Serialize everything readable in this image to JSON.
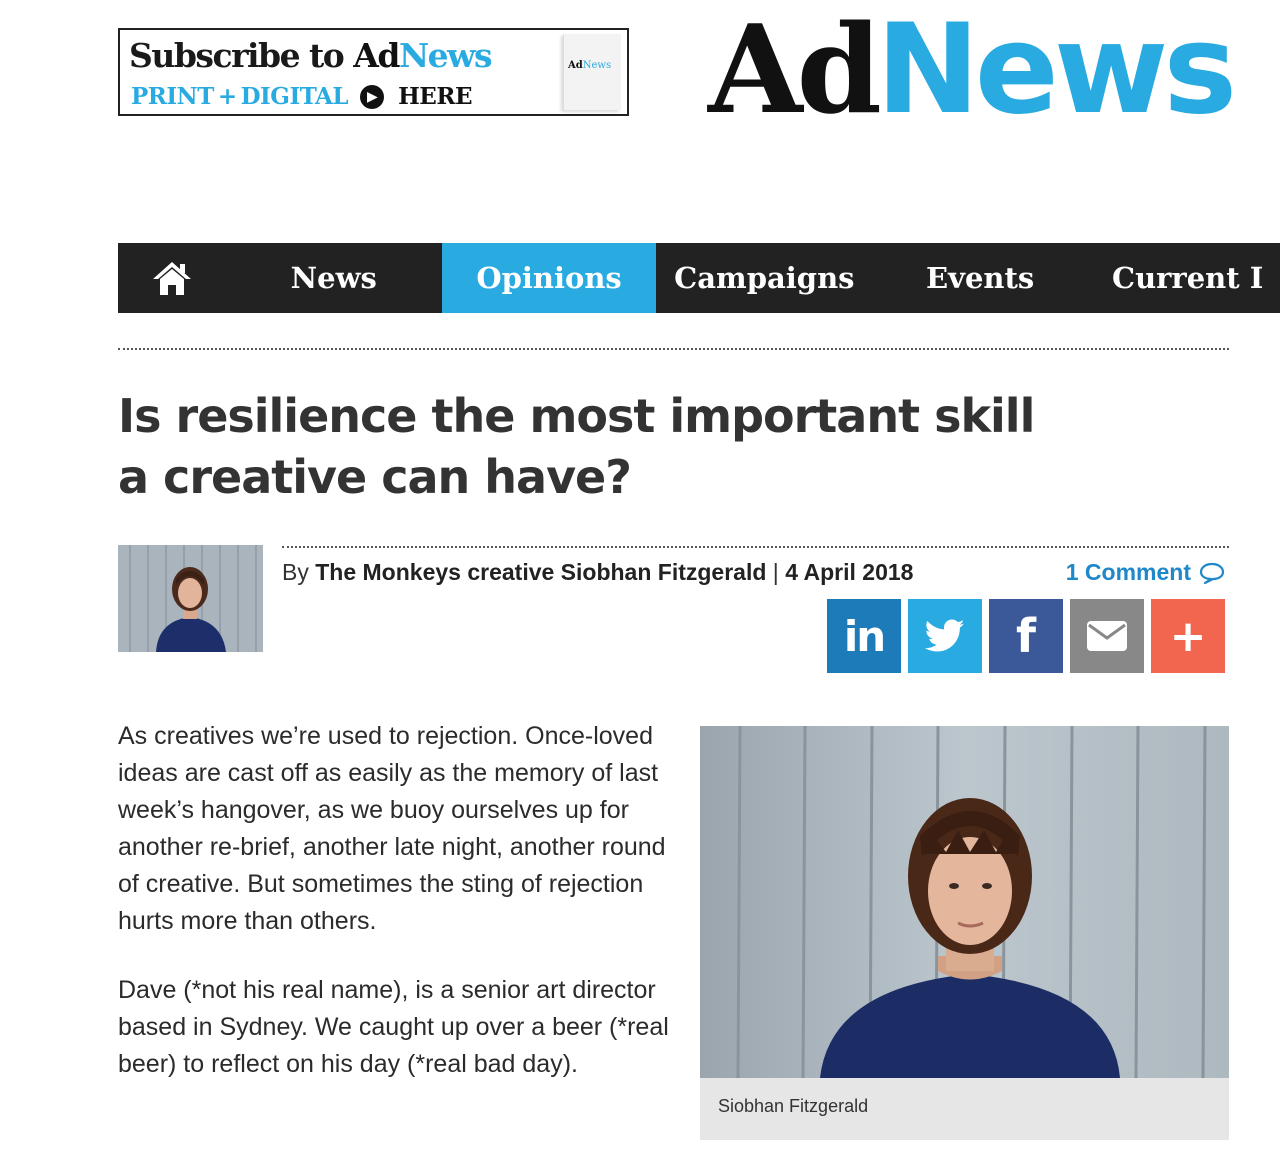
{
  "subscribe": {
    "line1_prefix": "Subscribe to ",
    "line1_ad": "Ad",
    "line1_news": "News",
    "line2_print": "PRINT",
    "line2_plus": "+",
    "line2_digital": "DIGITAL",
    "line2_here": "HERE",
    "thumb_ad": "Ad",
    "thumb_news": "News"
  },
  "logo": {
    "ad": "Ad",
    "news": "News"
  },
  "nav": {
    "home_icon": "home-icon",
    "items": [
      {
        "label": "News"
      },
      {
        "label": "Opinions",
        "active": true
      },
      {
        "label": "Campaigns"
      },
      {
        "label": "Events"
      },
      {
        "label": "Current I"
      }
    ]
  },
  "article": {
    "headline": "Is resilience the most important skill a creative can have?",
    "byline_prefix": "By ",
    "author": "The Monkeys creative Siobhan Fitzgerald",
    "separator": " | ",
    "date": "4 April 2018",
    "comments": "1 Comment",
    "share": {
      "linkedin_label": "in",
      "facebook_label": "f",
      "more_label": "+"
    },
    "paragraphs": [
      "As creatives we’re used to rejection. Once-loved ideas are cast off as easily as the memory of last week’s hangover, as we buoy ourselves up for another re-brief, another late night, another round of creative. But sometimes the sting of rejection hurts more than others.",
      "Dave (*not his real name), is a senior art director based in Sydney. We caught up over a beer (*real beer) to reflect on his day (*real bad day)."
    ],
    "figure_caption": "Siobhan Fitzgerald"
  },
  "colors": {
    "brand_blue": "#29abe2",
    "nav_bg": "#222222",
    "linkedin": "#1c7bb8",
    "twitter": "#29abe2",
    "facebook": "#3b5998",
    "email": "#888888",
    "more": "#f26650"
  }
}
